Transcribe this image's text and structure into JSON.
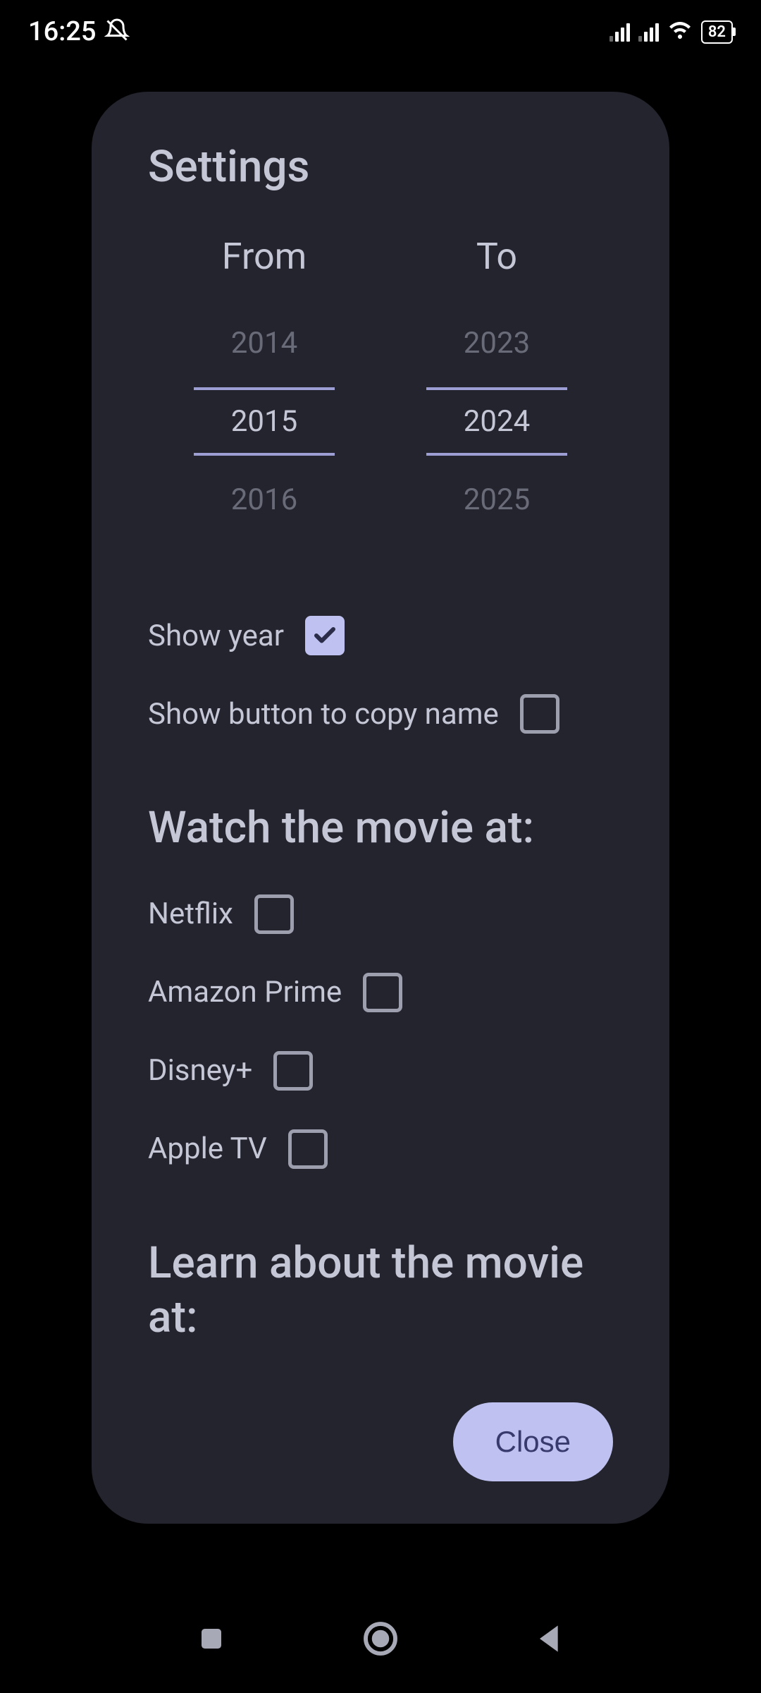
{
  "statusBar": {
    "time": "16:25",
    "battery": "82"
  },
  "dialog": {
    "title": "Settings",
    "yearFrom": {
      "label": "From",
      "prev": "2014",
      "selected": "2015",
      "next": "2016"
    },
    "yearTo": {
      "label": "To",
      "prev": "2023",
      "selected": "2024",
      "next": "2025"
    },
    "options": {
      "showYear": {
        "label": "Show year",
        "checked": true
      },
      "showCopyButton": {
        "label": "Show button to copy name",
        "checked": false
      }
    },
    "watchSection": {
      "heading": "Watch the movie at:",
      "providers": [
        {
          "label": "Netflix",
          "checked": false
        },
        {
          "label": "Amazon Prime",
          "checked": false
        },
        {
          "label": "Disney+",
          "checked": false
        },
        {
          "label": "Apple TV",
          "checked": false
        }
      ]
    },
    "learnSection": {
      "heading": "Learn about the movie at:"
    },
    "closeButton": "Close"
  }
}
